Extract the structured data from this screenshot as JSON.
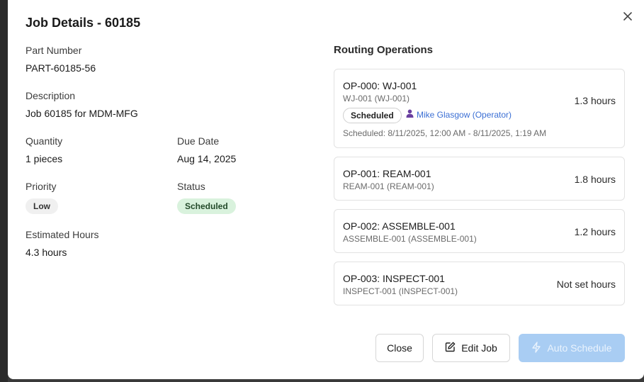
{
  "dialog": {
    "title": "Job Details - 60185",
    "close_icon": "close-icon"
  },
  "job": {
    "part_number_label": "Part Number",
    "part_number": "PART-60185-56",
    "description_label": "Description",
    "description": "Job 60185 for MDM-MFG",
    "quantity_label": "Quantity",
    "quantity": "1 pieces",
    "due_date_label": "Due Date",
    "due_date": "Aug 14, 2025",
    "priority_label": "Priority",
    "priority": "Low",
    "status_label": "Status",
    "status": "Scheduled",
    "estimated_hours_label": "Estimated Hours",
    "estimated_hours": "4.3 hours"
  },
  "routing": {
    "title": "Routing Operations",
    "operations": [
      {
        "name": "OP-000: WJ-001",
        "sub": "WJ-001 (WJ-001)",
        "hours": "1.3 hours",
        "status": "Scheduled",
        "operator": "Mike Glasgow (Operator)",
        "schedule": "Scheduled: 8/11/2025, 12:00 AM - 8/11/2025, 1:19 AM"
      },
      {
        "name": "OP-001: REAM-001",
        "sub": "REAM-001 (REAM-001)",
        "hours": "1.8 hours"
      },
      {
        "name": "OP-002: ASSEMBLE-001",
        "sub": "ASSEMBLE-001 (ASSEMBLE-001)",
        "hours": "1.2 hours"
      },
      {
        "name": "OP-003: INSPECT-001",
        "sub": "INSPECT-001 (INSPECT-001)",
        "hours": "Not set hours"
      }
    ]
  },
  "footer": {
    "close_label": "Close",
    "edit_label": "Edit Job",
    "auto_schedule_label": "Auto Schedule"
  },
  "colors": {
    "status_badge_bg": "#d9f2dd",
    "operator_link": "#3b6fd4",
    "primary_disabled": "#a9cdf3"
  }
}
